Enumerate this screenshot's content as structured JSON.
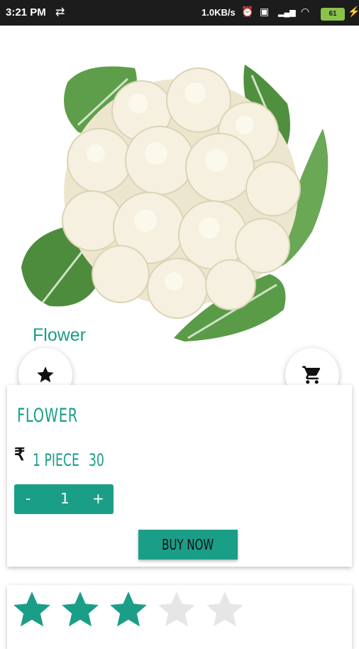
{
  "status_bar": {
    "time": "3:21 PM",
    "network_speed": "1.0KB/s",
    "battery_level": "61"
  },
  "product": {
    "label": "Flower",
    "title": "FLOWER",
    "currency_symbol": "₹",
    "unit": "1 PIECE",
    "price": "30"
  },
  "quantity": {
    "minus_label": "-",
    "value": "1",
    "plus_label": "+"
  },
  "actions": {
    "buy_label": "BUY NOW",
    "favorite_icon": "star-icon",
    "cart_icon": "cart-icon"
  },
  "rating": {
    "filled": 3,
    "total": 5
  },
  "colors": {
    "accent": "#1a9e87",
    "star_empty": "#e6e6e6",
    "status_bar": "#1c1c1c"
  }
}
